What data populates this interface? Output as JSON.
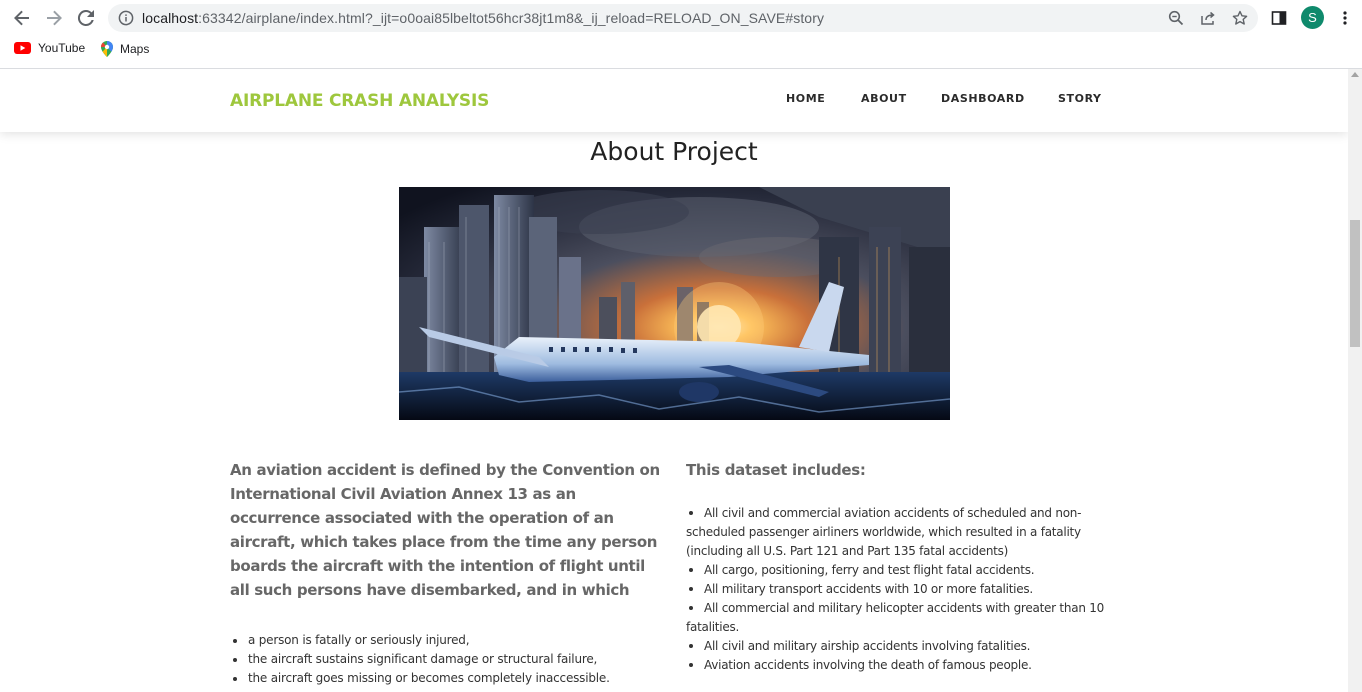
{
  "browser": {
    "url_host": "localhost",
    "url_rest": ":63342/airplane/index.html?_ijt=o0oai85lbeltot56hcr38jt1m8&_ij_reload=RELOAD_ON_SAVE#story",
    "avatar_letter": "S",
    "bookmarks": [
      {
        "label": "YouTube",
        "icon": "youtube-icon"
      },
      {
        "label": "Maps",
        "icon": "maps-icon"
      }
    ]
  },
  "site": {
    "logo": "AIRPLANE CRASH ANALYSIS",
    "accent_color": "#9ec73d",
    "nav": [
      {
        "label": "HOME"
      },
      {
        "label": "ABOUT"
      },
      {
        "label": "DASHBOARD"
      },
      {
        "label": "STORY"
      }
    ]
  },
  "about": {
    "title": "About Project",
    "hero_image": "airplane-crash-city-image",
    "lead": "An aviation accident is defined by the Convention on International Civil Aviation Annex 13 as an occurrence associated with the operation of an aircraft, which takes place from the time any person boards the aircraft with the intention of flight until all such persons have disembarked, and in which",
    "bullets": [
      "a person is fatally or seriously injured,",
      "the aircraft sustains significant damage or structural failure,",
      "the aircraft goes missing or becomes completely inaccessible."
    ],
    "dataset_heading": "This dataset includes:",
    "dataset_items": [
      "All civil and commercial aviation accidents of scheduled and non- scheduled passenger airliners worldwide, which resulted in a fatality (including all U.S. Part 121 and Part 135 fatal accidents)",
      "All cargo, positioning, ferry and test flight fatal accidents.",
      "All military transport accidents with 10 or more fatalities.",
      "All commercial and military helicopter accidents with greater than 10 fatalities.",
      "All civil and military airship accidents involving fatalities.",
      "Aviation accidents involving the death of famous people."
    ]
  }
}
